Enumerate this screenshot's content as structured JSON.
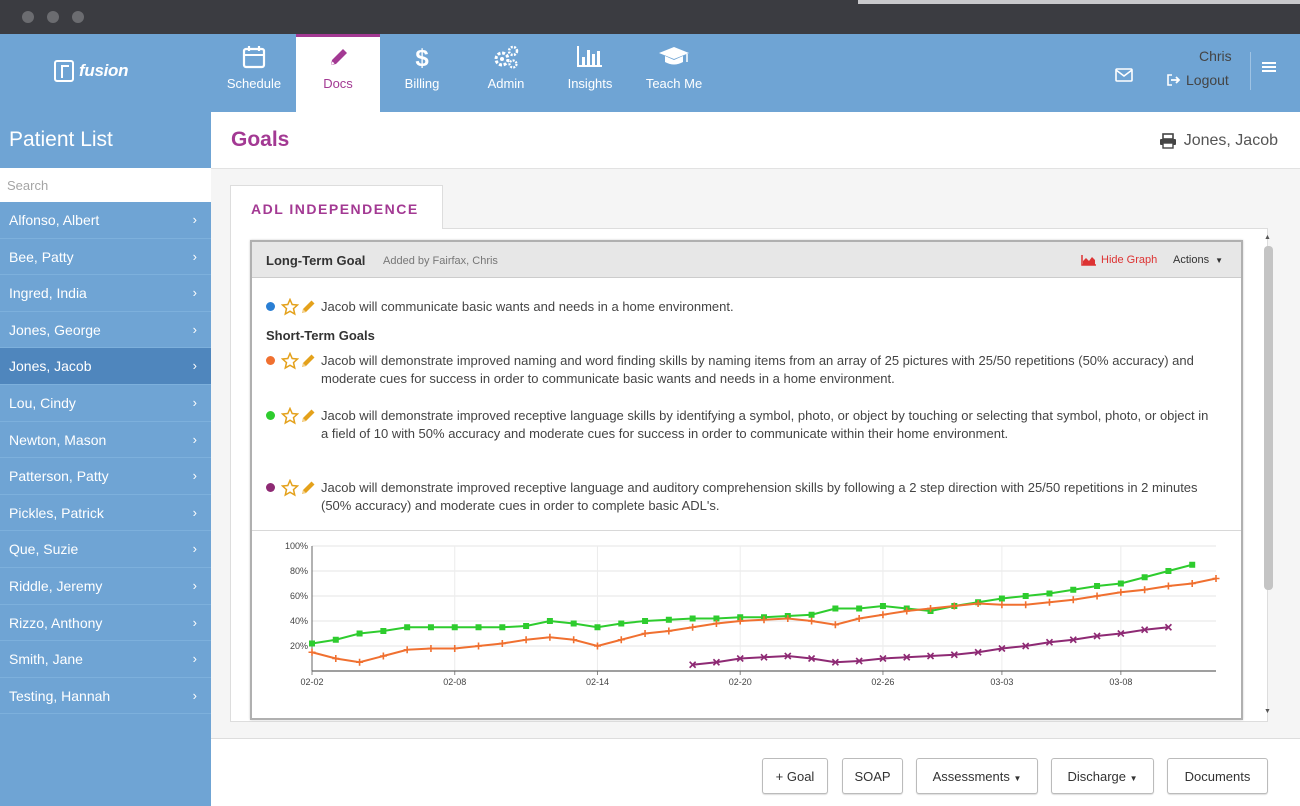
{
  "app": {
    "logo_text": "fusion"
  },
  "nav": {
    "tabs": [
      {
        "label": "Schedule",
        "icon": "calendar-icon"
      },
      {
        "label": "Docs",
        "icon": "pencil-icon",
        "active": true
      },
      {
        "label": "Billing",
        "icon": "dollar-icon"
      },
      {
        "label": "Admin",
        "icon": "gears-icon"
      },
      {
        "label": "Insights",
        "icon": "bar-chart-icon"
      },
      {
        "label": "Teach Me",
        "icon": "graduation-cap-icon"
      }
    ],
    "user_name": "Chris",
    "logout_label": "Logout"
  },
  "sidebar": {
    "title": "Patient List",
    "search_placeholder": "Search",
    "patients": [
      "Alfonso, Albert",
      "Bee, Patty",
      "Ingred, India",
      "Jones, George",
      "Jones, Jacob",
      "Lou, Cindy",
      "Newton, Mason",
      "Patterson, Patty",
      "Pickles, Patrick",
      "Que, Suzie",
      "Riddle, Jeremy",
      "Rizzo, Anthony",
      "Smith, Jane",
      "Testing, Hannah"
    ],
    "selected_patient": "Jones, Jacob"
  },
  "page": {
    "title": "Goals",
    "patient_name": "Jones, Jacob",
    "tab_label": "ADL INDEPENDENCE"
  },
  "goal_card": {
    "title": "Long-Term Goal",
    "added_by": "Added by Fairfax, Chris",
    "hide_graph_label": "Hide Graph",
    "actions_label": "Actions",
    "long_term_goal": {
      "text": "Jacob will communicate basic wants and needs in a home environment.",
      "color": "#2a7fd4"
    },
    "short_term_label": "Short-Term Goals",
    "short_term_goals": [
      {
        "text": "Jacob will demonstrate improved naming and word finding skills by naming items from an array of 25 pictures with 25/50 repetitions (50% accuracy) and moderate cues for success in order to communicate basic wants and needs in a home environment.",
        "color": "#f07030"
      },
      {
        "text": "Jacob will demonstrate improved receptive language skills by identifying a symbol, photo, or object by touching or selecting that symbol, photo, or object in a field of 10 with 50% accuracy and moderate cues for success in order to communicate within their home environment.",
        "color": "#2ecc2e"
      },
      {
        "text": "Jacob will demonstrate improved receptive language and auditory comprehension skills by following a 2 step direction with 25/50 repetitions in 2 minutes (50% accuracy) and moderate cues in order to complete basic ADL's.",
        "color": "#8e2a74"
      }
    ]
  },
  "chart_data": {
    "type": "line",
    "x_tick_labels": [
      "02-02",
      "02-08",
      "02-14",
      "02-20",
      "02-26",
      "03-03",
      "03-08"
    ],
    "x_domain": [
      "02-02",
      "03-12"
    ],
    "yticks": [
      "20%",
      "40%",
      "60%",
      "80%",
      "100%"
    ],
    "ylim": [
      0,
      100
    ],
    "grid": true,
    "series": [
      {
        "color": "#2ecc2e",
        "marker": "square",
        "x": [
          "02-02",
          "02-03",
          "02-04",
          "02-05",
          "02-06",
          "02-07",
          "02-08",
          "02-09",
          "02-10",
          "02-11",
          "02-12",
          "02-13",
          "02-14",
          "02-15",
          "02-16",
          "02-17",
          "02-18",
          "02-19",
          "02-20",
          "02-21",
          "02-22",
          "02-23",
          "02-24",
          "02-25",
          "02-26",
          "02-27",
          "02-28",
          "03-01",
          "03-02",
          "03-03",
          "03-04",
          "03-05",
          "03-06",
          "03-07",
          "03-08",
          "03-09",
          "03-10",
          "03-11"
        ],
        "y": [
          22,
          25,
          30,
          32,
          35,
          35,
          35,
          35,
          35,
          36,
          40,
          38,
          35,
          38,
          40,
          41,
          42,
          42,
          43,
          43,
          44,
          45,
          50,
          50,
          52,
          50,
          48,
          52,
          55,
          58,
          60,
          62,
          65,
          68,
          70,
          75,
          80,
          85
        ]
      },
      {
        "color": "#f07030",
        "marker": "plus",
        "x": [
          "02-02",
          "02-03",
          "02-04",
          "02-05",
          "02-06",
          "02-07",
          "02-08",
          "02-09",
          "02-10",
          "02-11",
          "02-12",
          "02-13",
          "02-14",
          "02-15",
          "02-16",
          "02-17",
          "02-18",
          "02-19",
          "02-20",
          "02-21",
          "02-22",
          "02-23",
          "02-24",
          "02-25",
          "02-26",
          "02-27",
          "02-28",
          "03-01",
          "03-02",
          "03-03",
          "03-04",
          "03-05",
          "03-06",
          "03-07",
          "03-08",
          "03-09",
          "03-10",
          "03-11",
          "03-12"
        ],
        "y": [
          15,
          10,
          7,
          12,
          17,
          18,
          18,
          20,
          22,
          25,
          27,
          25,
          20,
          25,
          30,
          32,
          35,
          38,
          40,
          41,
          42,
          40,
          37,
          42,
          45,
          48,
          50,
          52,
          54,
          53,
          53,
          55,
          57,
          60,
          63,
          65,
          68,
          70,
          74
        ]
      },
      {
        "color": "#8e2a74",
        "marker": "x",
        "x": [
          "02-18",
          "02-19",
          "02-20",
          "02-21",
          "02-22",
          "02-23",
          "02-24",
          "02-25",
          "02-26",
          "02-27",
          "02-28",
          "03-01",
          "03-02",
          "03-03",
          "03-04",
          "03-05",
          "03-06",
          "03-07",
          "03-08",
          "03-09",
          "03-10"
        ],
        "y": [
          5,
          7,
          10,
          11,
          12,
          10,
          7,
          8,
          10,
          11,
          12,
          13,
          15,
          18,
          20,
          23,
          25,
          28,
          30,
          33,
          35
        ]
      }
    ]
  },
  "bottom_buttons": [
    "+ Goal",
    "SOAP",
    "Assessments",
    "Discharge",
    "Documents"
  ]
}
